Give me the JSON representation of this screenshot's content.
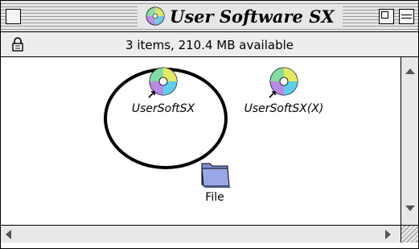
{
  "window": {
    "title": "User Software SX",
    "info": "3 items, 210.4 MB available",
    "title_icon": "cd-disc-icon"
  },
  "items": [
    {
      "label": "UserSoftSX",
      "icon": "cd-alias-icon",
      "italic": true,
      "highlighted": true
    },
    {
      "label": "UserSoftSX(X)",
      "icon": "cd-alias-icon",
      "italic": true,
      "highlighted": false
    },
    {
      "label": "File",
      "icon": "folder-icon",
      "italic": false,
      "highlighted": false
    }
  ],
  "colors": {
    "folder": "#7f8fd6",
    "chrome": "#e6e6e6",
    "background": "#ffffff"
  }
}
